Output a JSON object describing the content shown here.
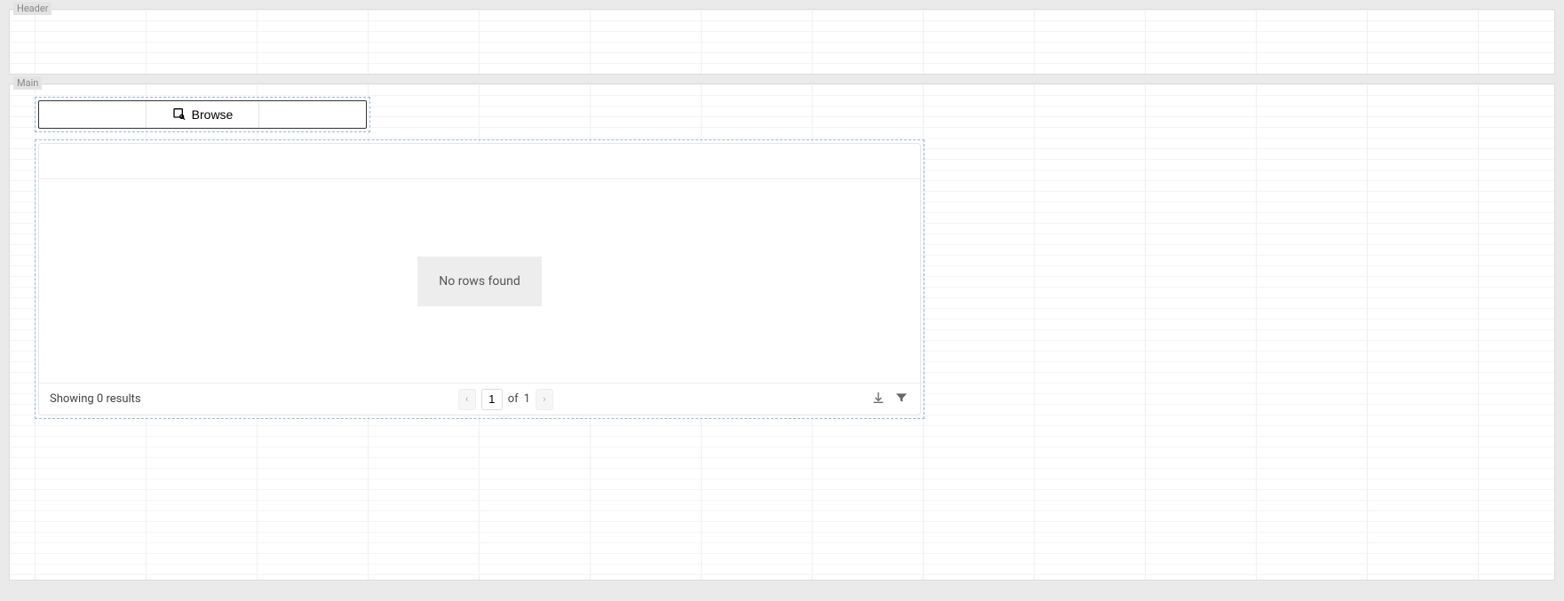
{
  "sections": {
    "header_label": "Header",
    "main_label": "Main"
  },
  "browse": {
    "label": "Browse"
  },
  "table": {
    "empty_message": "No rows found",
    "footer": {
      "results_text": "Showing 0 results",
      "page_current": "1",
      "page_of_label": "of",
      "page_total": "1"
    }
  }
}
